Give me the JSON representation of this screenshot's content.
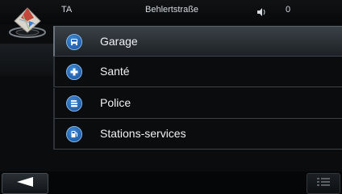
{
  "status": {
    "left_label": "TA",
    "street": "Behlertstraße",
    "volume_icon": "speaker-icon",
    "count": "0"
  },
  "list": {
    "items": [
      {
        "label": "Garage",
        "icon": "car-repair-icon",
        "selected": true
      },
      {
        "label": "Santé",
        "icon": "medical-cross-icon",
        "selected": false
      },
      {
        "label": "Police",
        "icon": "police-icon",
        "selected": false
      },
      {
        "label": "Stations-services",
        "icon": "fuel-pump-icon",
        "selected": false
      }
    ]
  },
  "colors": {
    "accent": "#2c6fc4",
    "background": "#0b0c0e",
    "selected_row": "#3a4147"
  }
}
